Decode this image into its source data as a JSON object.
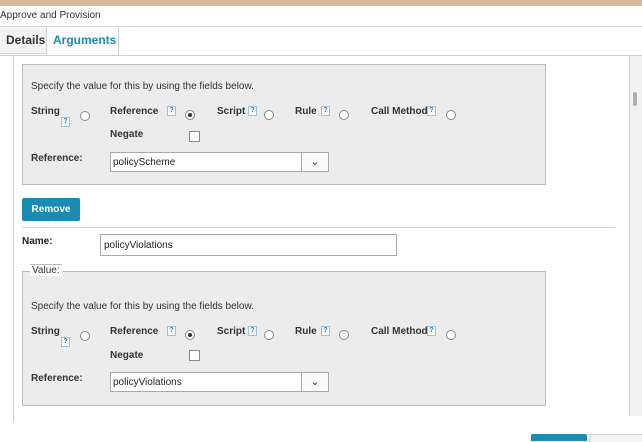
{
  "window": {
    "title": "Approve and Provision"
  },
  "tabs": {
    "details": "Details",
    "arguments": "Arguments"
  },
  "help_glyph": "?",
  "dropdown_glyph": "⌄",
  "accent_color": "#1a8bb3",
  "block1": {
    "instructions": "Specify the value for this by using the fields below.",
    "options": {
      "string": "String",
      "reference": "Reference",
      "script": "Script",
      "rule": "Rule",
      "call_method": "Call Method"
    },
    "selected": "reference",
    "negate_label": "Negate",
    "reference_label": "Reference:",
    "reference_value": "policyScheme"
  },
  "remove_button": "Remove",
  "arg2": {
    "name_label": "Name:",
    "name_value": "policyViolations",
    "value_legend": "Value:"
  },
  "block2": {
    "instructions": "Specify the value for this by using the fields below.",
    "options": {
      "string": "String",
      "reference": "Reference",
      "script": "Script",
      "rule": "Rule",
      "call_method": "Call Method"
    },
    "selected": "reference",
    "negate_label": "Negate",
    "reference_label": "Reference:",
    "reference_value": "policyViolations"
  }
}
